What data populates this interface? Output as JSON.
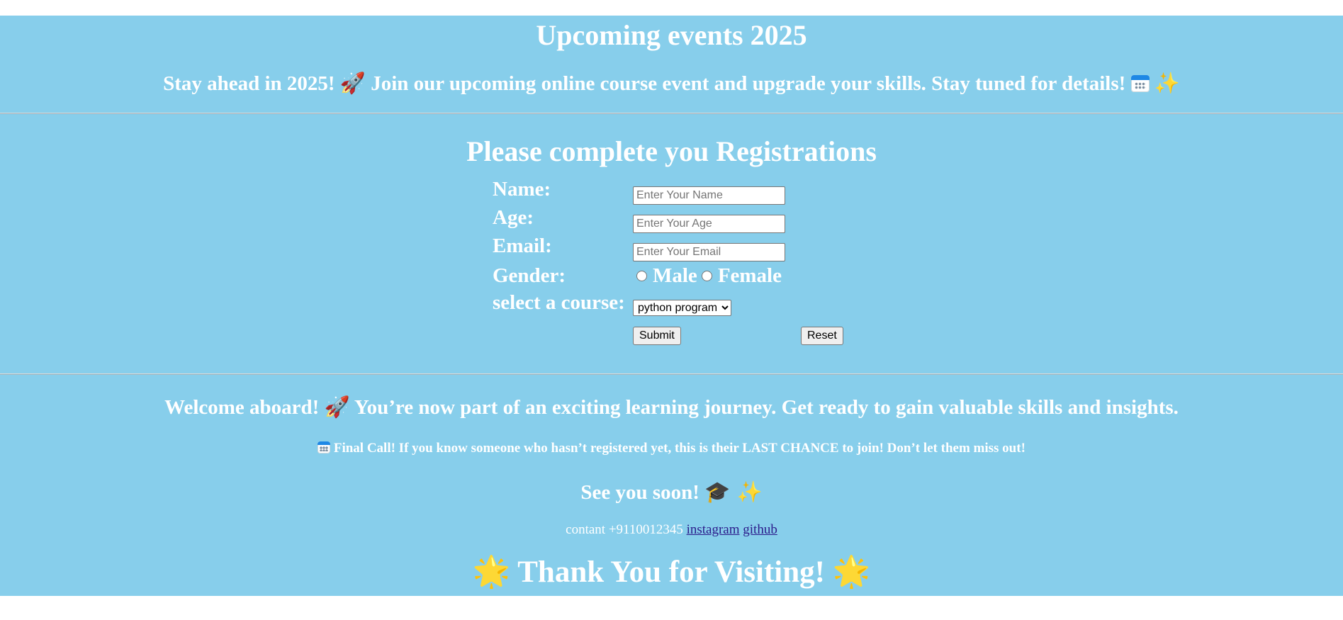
{
  "header": {
    "title": "Upcoming events 2025",
    "intro_text_1": "Stay ahead in 2025! ",
    "intro_emoji_rocket": "🚀",
    "intro_text_2": " Join our upcoming online course event and upgrade your skills. Stay tuned for details! ",
    "intro_emoji_sparkles": "✨"
  },
  "form": {
    "title": "Please complete you Registrations",
    "name_label": "Name:",
    "name_placeholder": "Enter Your Name",
    "age_label": "Age:",
    "age_placeholder": "Enter Your Age",
    "email_label": "Email:",
    "email_placeholder": "Enter Your Email",
    "gender_label": "Gender:",
    "gender_male": "Male",
    "gender_female": "Female",
    "course_label": "select a course:",
    "course_selected": "python program",
    "submit_label": "Submit",
    "reset_label": "Reset"
  },
  "footer": {
    "welcome_text_1": "Welcome aboard! ",
    "welcome_emoji": "🚀",
    "welcome_text_2": " You’re now part of an exciting learning journey. Get ready to gain valuable skills and insights.",
    "final_call": " Final Call! If you know someone who hasn’t registered yet, this is their LAST CHANCE to join! Don’t let them miss out!",
    "see_you": "See you soon! ",
    "see_you_emoji_1": "🎓",
    "see_you_emoji_2": " ✨",
    "contact_text": "contant +9110012345 ",
    "instagram_label": "instagram",
    "github_label": "github",
    "thanks_emoji_left": "🌟",
    "thanks_text": " Thank You for Visiting! ",
    "thanks_emoji_right": "🌟"
  },
  "colors": {
    "background": "#87ceeb",
    "text": "#ffffff",
    "link": "#2b1b8a"
  },
  "icons": [
    "rocket-icon",
    "calendar-icon",
    "sparkles-icon",
    "graduation-cap-icon",
    "glowing-star-icon"
  ]
}
